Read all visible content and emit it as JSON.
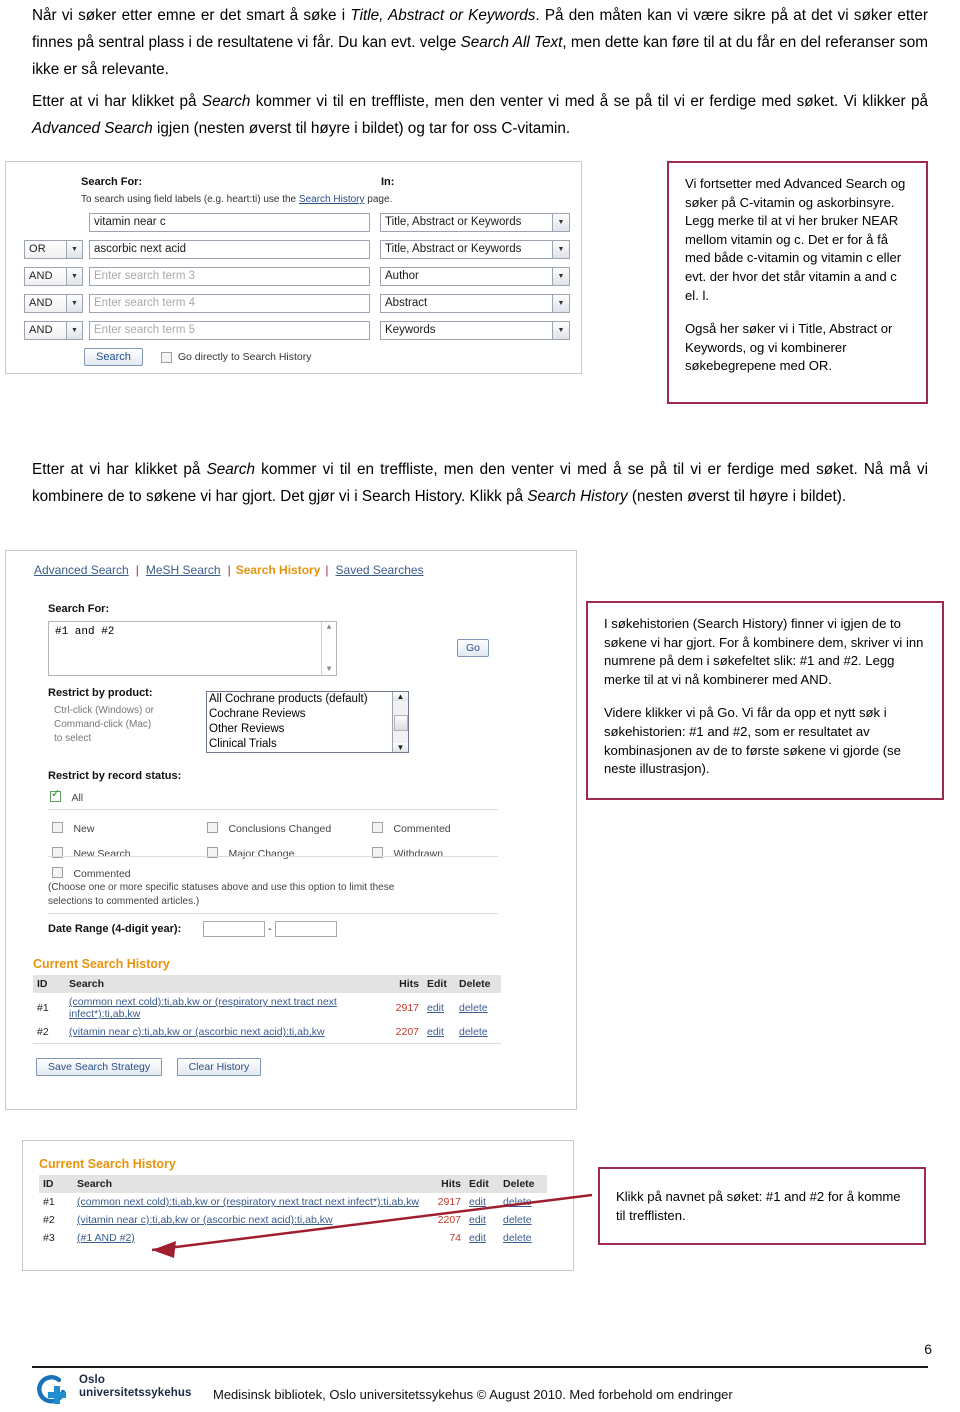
{
  "document": {
    "page_number": "6",
    "footer_text": "Medisinsk bibliotek, Oslo universitetssykehus  © August 2010. Med forbehold om endringer",
    "logo": {
      "line1": "Oslo",
      "line2": "universitetssykehus"
    }
  },
  "paragraphs": {
    "p1_a": "Når vi søker etter emne er det smart å søke i ",
    "p1_i1": "Title, Abstract or Keywords",
    "p1_b": ". På den måten kan vi være sikre på at det vi søker etter finnes på sentral plass i de resultatene vi får. Du kan evt. velge ",
    "p1_i2": "Search All Text",
    "p1_c": ", men dette kan føre til at du får en del referanser som ikke er så relevante.",
    "p2_a": "Etter at vi har klikket på ",
    "p2_i1": "Search",
    "p2_b": " kommer vi til en treffliste, men den venter vi med å se på til vi er ferdige med søket. Vi klikker på ",
    "p2_i2": "Advanced Search",
    "p2_c": " igjen (nesten øverst til høyre i bildet) og tar for oss C-vitamin.",
    "p3_a": "Etter at vi har klikket på ",
    "p3_i1": "Search",
    "p3_b": " kommer vi til en treffliste, men den venter vi med å se på til vi er ferdige med søket. Nå må vi kombinere de to søkene vi har gjort. Det gjør vi i Search History. Klikk på ",
    "p3_i2": "Search History",
    "p3_c": " (nesten øverst til høyre i bildet)."
  },
  "callouts": {
    "first": {
      "p1": "Vi fortsetter med Advanced Search og søker på C-vitamin og askorbinsyre. Legg merke til at vi her bruker NEAR mellom vitamin og c. Det er for å få med både c-vitamin og vitamin c eller evt. der hvor det står vitamin a and c el. l.",
      "p2": "Også her søker vi i Title, Abstract or Keywords, og vi kombinerer søkebegrepene med OR."
    },
    "second": {
      "p1": "I søkehistorien (Search History) finner vi igjen de to søkene vi har gjort. For å kombinere dem, skriver vi inn numrene på dem i søkefeltet slik: #1 and #2. Legg merke til at vi nå kombinerer med AND.",
      "p2": "Videre klikker vi på Go. Vi får da opp et nytt søk i søkehistorien: #1 and #2, som er resultatet av kombinasjonen av de to første søkene vi gjorde (se neste illustrasjon)."
    },
    "third": {
      "p1": "Klikk på navnet på søket: #1 and #2 for å komme til trefflisten."
    }
  },
  "advanced_search": {
    "search_for_label": "Search For:",
    "in_label": "In:",
    "hint_before": "To search using field labels (e.g. heart:ti) use the ",
    "hint_link": "Search History",
    "hint_after": " page.",
    "rows": [
      {
        "bool": "",
        "term": "vitamin near c",
        "is_placeholder": false,
        "field": "Title, Abstract or Keywords"
      },
      {
        "bool": "OR",
        "term": "ascorbic next acid",
        "is_placeholder": false,
        "field": "Title, Abstract or Keywords"
      },
      {
        "bool": "AND",
        "term": "Enter search term 3",
        "is_placeholder": true,
        "field": "Author"
      },
      {
        "bool": "AND",
        "term": "Enter search term 4",
        "is_placeholder": true,
        "field": "Abstract"
      },
      {
        "bool": "AND",
        "term": "Enter search term 5",
        "is_placeholder": true,
        "field": "Keywords"
      }
    ],
    "search_button": "Search",
    "go_direct_label": "Go directly to Search History"
  },
  "search_history_page": {
    "nav": {
      "advanced_search": "Advanced Search",
      "mesh_search": "MeSH Search",
      "search_history": "Search History",
      "saved_searches": "Saved Searches",
      "separator": "|"
    },
    "search_for_label": "Search For:",
    "search_value": "#1 and #2",
    "go_button": "Go",
    "restrict_product_label": "Restrict by product:",
    "restrict_product_hint_1": "Ctrl-click (Windows) or",
    "restrict_product_hint_2": "Command-click (Mac)",
    "restrict_product_hint_3": "to select",
    "product_options": [
      "All Cochrane products (default)",
      "Cochrane Reviews",
      "Other Reviews",
      "Clinical Trials"
    ],
    "restrict_status_label": "Restrict by record status:",
    "status_all": "All",
    "status_all_checked": true,
    "status_checkboxes": [
      "New",
      "Conclusions Changed",
      "Commented",
      "New Search",
      "Major Change",
      "Withdrawn"
    ],
    "commented_label": "Commented",
    "commented_note_1": "(Choose one or more specific statuses above and use this option to limit these",
    "commented_note_2": "selections to commented articles.)",
    "date_range_label": "Date Range (4-digit year):",
    "date_from": "",
    "date_to": "",
    "date_separator": "-",
    "history_title": "Current Search History",
    "history_columns": [
      "ID",
      "Search",
      "Hits",
      "Edit",
      "Delete"
    ],
    "history_rows_2": [
      {
        "id": "#1",
        "search": "(common next cold):ti,ab,kw or (respiratory next tract next infect*):ti,ab,kw",
        "hits": "2917",
        "edit": "edit",
        "delete": "delete"
      },
      {
        "id": "#2",
        "search": "(vitamin near c):ti,ab,kw or (ascorbic next acid):ti,ab,kw",
        "hits": "2207",
        "edit": "edit",
        "delete": "delete"
      }
    ],
    "save_strategy_button": "Save Search Strategy",
    "clear_history_button": "Clear History"
  },
  "search_history_result": {
    "history_title": "Current Search History",
    "history_columns": [
      "ID",
      "Search",
      "Hits",
      "Edit",
      "Delete"
    ],
    "history_rows_3": [
      {
        "id": "#1",
        "search": "(common next cold):ti,ab,kw or (respiratory next tract next infect*):ti,ab,kw",
        "hits": "2917",
        "edit": "edit",
        "delete": "delete"
      },
      {
        "id": "#2",
        "search": "(vitamin near c):ti,ab,kw or (ascorbic next acid):ti,ab,kw",
        "hits": "2207",
        "edit": "edit",
        "delete": "delete"
      },
      {
        "id": "#3",
        "search": "(#1 AND #2)",
        "hits": "74",
        "edit": "edit",
        "delete": "delete"
      }
    ]
  },
  "colors": {
    "callout_border": "#9e2b4c",
    "accent_orange": "#e8930c",
    "link_blue": "#3a5d8f",
    "hits_red": "#c0392b",
    "arrow_red": "#a01f2e"
  }
}
